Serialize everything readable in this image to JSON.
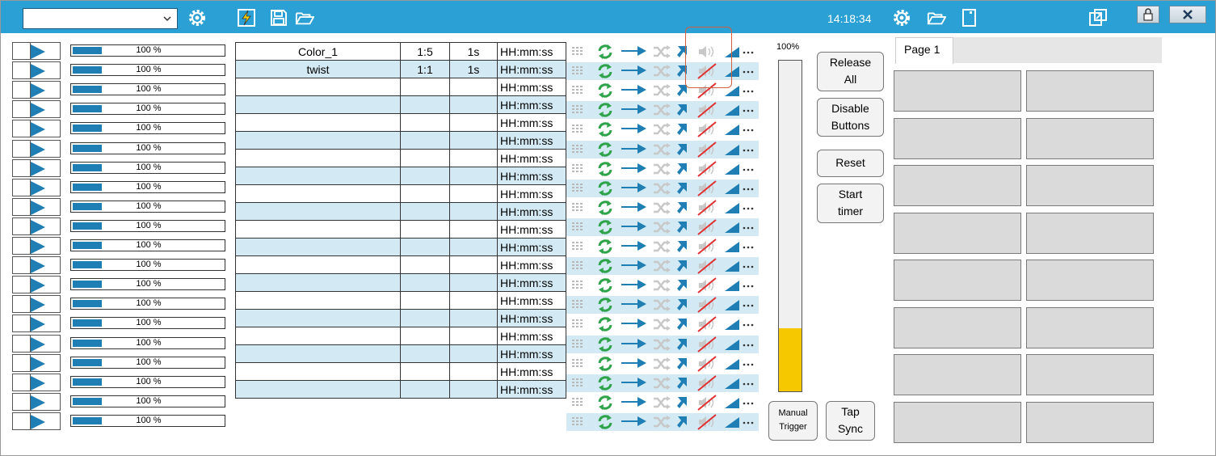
{
  "toolbar": {
    "dropdown_value": "",
    "clock": "14:18:34",
    "icons": [
      "settings-icon",
      "lightning-icon",
      "save-icon",
      "open-folder-icon",
      "settings-icon",
      "open-folder-icon",
      "new-document-icon",
      "restore-window-icon",
      "lock-icon",
      "close-icon"
    ]
  },
  "cuelists": [
    {
      "level": "100 %",
      "level_fraction": 1.0,
      "name": "Color_1",
      "ratio": "1:5",
      "fade": "1s",
      "time": "HH:mm:ss"
    },
    {
      "level": "100 %",
      "level_fraction": 1.0,
      "name": "twist",
      "ratio": "1:1",
      "fade": "1s",
      "time": "HH:mm:ss"
    },
    {
      "level": "100 %",
      "level_fraction": 1.0,
      "name": "",
      "ratio": "",
      "fade": "",
      "time": "HH:mm:ss"
    },
    {
      "level": "100 %",
      "level_fraction": 1.0,
      "name": "",
      "ratio": "",
      "fade": "",
      "time": "HH:mm:ss"
    },
    {
      "level": "100 %",
      "level_fraction": 1.0,
      "name": "",
      "ratio": "",
      "fade": "",
      "time": "HH:mm:ss"
    },
    {
      "level": "100 %",
      "level_fraction": 1.0,
      "name": "",
      "ratio": "",
      "fade": "",
      "time": "HH:mm:ss"
    },
    {
      "level": "100 %",
      "level_fraction": 1.0,
      "name": "",
      "ratio": "",
      "fade": "",
      "time": "HH:mm:ss"
    },
    {
      "level": "100 %",
      "level_fraction": 1.0,
      "name": "",
      "ratio": "",
      "fade": "",
      "time": "HH:mm:ss"
    },
    {
      "level": "100 %",
      "level_fraction": 1.0,
      "name": "",
      "ratio": "",
      "fade": "",
      "time": "HH:mm:ss"
    },
    {
      "level": "100 %",
      "level_fraction": 1.0,
      "name": "",
      "ratio": "",
      "fade": "",
      "time": "HH:mm:ss"
    },
    {
      "level": "100 %",
      "level_fraction": 1.0,
      "name": "",
      "ratio": "",
      "fade": "",
      "time": "HH:mm:ss"
    },
    {
      "level": "100 %",
      "level_fraction": 1.0,
      "name": "",
      "ratio": "",
      "fade": "",
      "time": "HH:mm:ss"
    },
    {
      "level": "100 %",
      "level_fraction": 1.0,
      "name": "",
      "ratio": "",
      "fade": "",
      "time": "HH:mm:ss"
    },
    {
      "level": "100 %",
      "level_fraction": 1.0,
      "name": "",
      "ratio": "",
      "fade": "",
      "time": "HH:mm:ss"
    },
    {
      "level": "100 %",
      "level_fraction": 1.0,
      "name": "",
      "ratio": "",
      "fade": "",
      "time": "HH:mm:ss"
    },
    {
      "level": "100 %",
      "level_fraction": 1.0,
      "name": "",
      "ratio": "",
      "fade": "",
      "time": "HH:mm:ss"
    },
    {
      "level": "100 %",
      "level_fraction": 1.0,
      "name": "",
      "ratio": "",
      "fade": "",
      "time": "HH:mm:ss"
    },
    {
      "level": "100 %",
      "level_fraction": 1.0,
      "name": "",
      "ratio": "",
      "fade": "",
      "time": "HH:mm:ss"
    },
    {
      "level": "100 %",
      "level_fraction": 1.0,
      "name": "",
      "ratio": "",
      "fade": "",
      "time": "HH:mm:ss"
    },
    {
      "level": "100 %",
      "level_fraction": 1.0,
      "name": "",
      "ratio": "",
      "fade": "",
      "time": "HH:mm:ss"
    }
  ],
  "row_icons": [
    "grid-icon",
    "loop-icon",
    "forward-arrow-icon",
    "shuffle-icon",
    "jump-up-arrow-icon",
    "sound-muted-icon",
    "fade-ramp-icon",
    "more-icon"
  ],
  "master": {
    "label": "100%",
    "level_fraction": 0.19
  },
  "buttons": {
    "release_all": "Release\nAll",
    "disable_buttons": "Disable\nButtons",
    "reset": "Reset",
    "start_timer": "Start\ntimer",
    "manual_trigger": "Manual\nTrigger",
    "tap_sync": "Tap\nSync"
  },
  "pages": {
    "tab_label": "Page 1",
    "button_count": 16
  },
  "colors": {
    "topbar": "#2aa0d4",
    "accent": "#1f7fb4",
    "alt_row": "#d3eaf4",
    "master_fill": "#f5c800",
    "loop": "#2fa34a",
    "mute_slash": "#e03030"
  }
}
